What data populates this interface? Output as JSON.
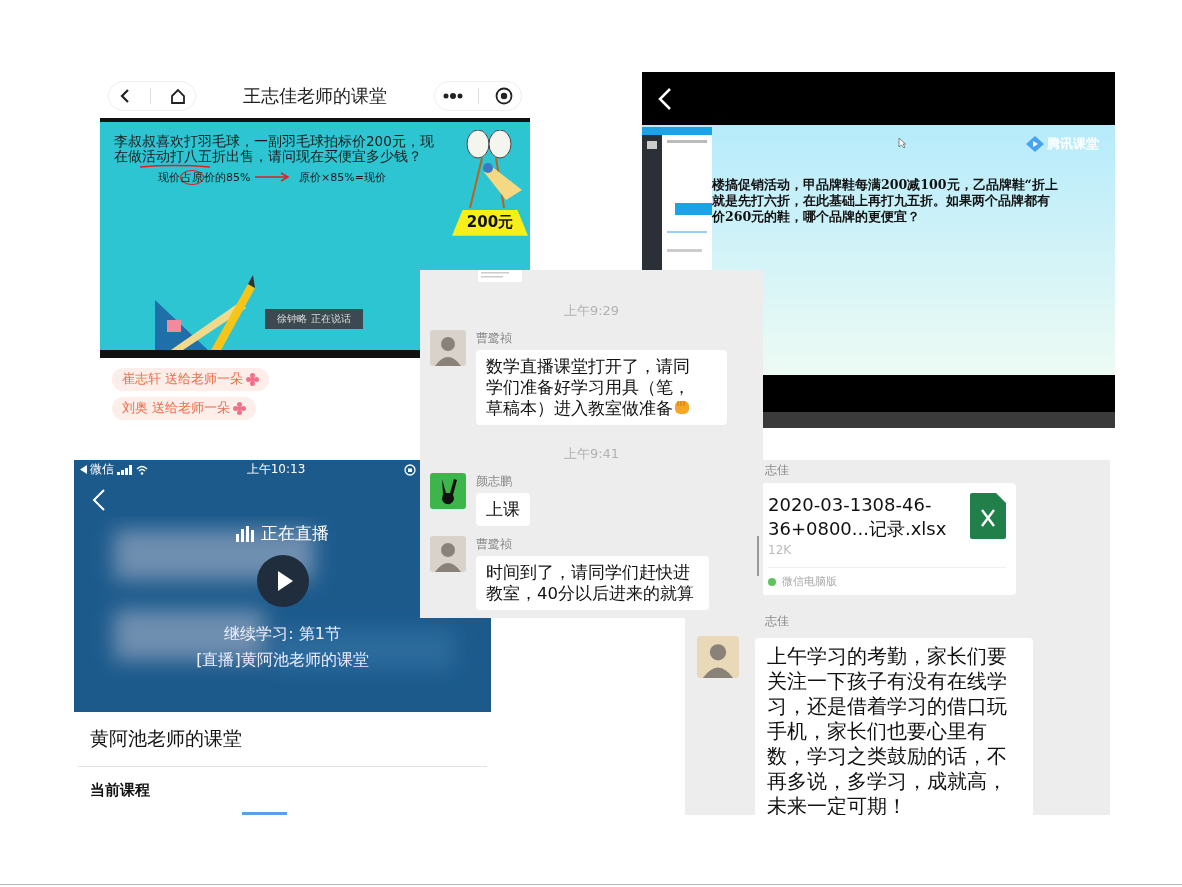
{
  "classroom_live": {
    "nav_title": "王志佳老师的课堂",
    "slide": {
      "problem": "李叔叔喜欢打羽毛球，一副羽毛球拍标价200元，现在做活动打八五折出售，请问现在买便宜多少钱？",
      "note_left": "现价占原价的85%",
      "note_right": "原价×85%=现价",
      "price_tag": "200元",
      "speaker": "徐钟略 正在说话"
    },
    "gifts": [
      {
        "text": "崔志轩 送给老师一朵"
      },
      {
        "text": "刘奥 送给老师一朵"
      }
    ]
  },
  "video_lesson": {
    "logo": "腾讯课堂",
    "problem_lines": [
      "楼搞促销活动，甲品牌鞋每满200减100元，乙品牌鞋“折上",
      "就是先打六折，在此基础上再打九五折。如果两个品牌都有",
      "价260元的鞋，哪个品牌的更便宜？"
    ]
  },
  "live_course": {
    "status_bar": {
      "carrier": "微信",
      "time": "上午10:13"
    },
    "live_label": "正在直播",
    "continue_label": "继续学习: 第1节",
    "lesson_title": "[直播]黄阿池老师的课堂",
    "course_title": "黄阿池老师的课堂",
    "section": "当前课程"
  },
  "file_chat": {
    "messages": [
      {
        "kind": "file",
        "sender": "志佳",
        "file_name": "2020-03-1308-46-36+0800...记录.xlsx",
        "size": "12K",
        "source": "微信电脑版"
      },
      {
        "kind": "text",
        "sender": "志佳",
        "text": "上午学习的考勤，家长们要关注一下孩子有没有在线学习，还是借着学习的借口玩手机，家长们也要心里有数，学习之类鼓励的话，不再多说，多学习，成就高，未来一定可期！"
      }
    ]
  },
  "group_chat": {
    "messages": [
      {
        "kind": "time",
        "text": "上午9:29"
      },
      {
        "kind": "message",
        "sender": "曹鹭祯",
        "text": "数学直播课堂打开了，请同学们准备好学习用具（笔，草稿本）进入教室做准备",
        "emoji": true
      },
      {
        "kind": "time",
        "text": "上午9:41"
      },
      {
        "kind": "message",
        "sender": "颜志鹏",
        "avatar": {
          "kind": "gesture"
        },
        "text": "上课",
        "emoji": false
      },
      {
        "kind": "message",
        "sender": "曹鹭祯",
        "text": "时间到了，请同学们赶快进教室，40分以后进来的就算",
        "emoji": false
      }
    ]
  }
}
